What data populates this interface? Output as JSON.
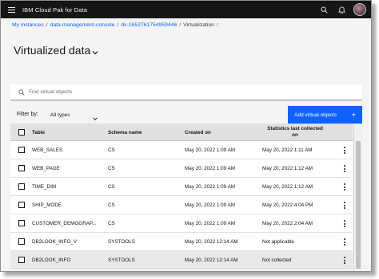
{
  "app": {
    "brand": "IBM Cloud Pak for Data"
  },
  "topbar": {
    "icons": [
      "menu-icon",
      "search-icon",
      "notification-icon",
      "avatar"
    ]
  },
  "breadcrumb": {
    "items": [
      "My instances",
      "data-management-console",
      "dv-1652761754959446",
      "Virtualization"
    ],
    "separator": "/"
  },
  "page": {
    "title": "Virtualized data"
  },
  "search": {
    "placeholder": "Find virtual objects",
    "value": ""
  },
  "filter": {
    "label": "Filter by:",
    "selected": "All types"
  },
  "actions": {
    "add_label": "Add virtual objects",
    "add_icon": "+"
  },
  "table": {
    "headers": {
      "table": "Table",
      "schema": "Schema name",
      "created": "Created on",
      "stats_line1": "Statistics last collected",
      "stats_line2": "on"
    },
    "rows": [
      {
        "table": "WEB_SALES",
        "schema": "CS",
        "created": "May 20, 2022 1:09 AM",
        "stats": "May 20, 2022 1:11 AM"
      },
      {
        "table": "WEB_PAGE",
        "schema": "CS",
        "created": "May 20, 2022 1:09 AM",
        "stats": "May 20, 2022 1:12 AM"
      },
      {
        "table": "TIME_DIM",
        "schema": "CS",
        "created": "May 20, 2022 1:09 AM",
        "stats": "May 20, 2022 1:12 AM"
      },
      {
        "table": "SHIP_MODE",
        "schema": "CS",
        "created": "May 20, 2022 1:09 AM",
        "stats": "May 20, 2022 4:04 PM"
      },
      {
        "table": "CUSTOMER_DEMOGRAP...",
        "schema": "CS",
        "created": "May 20, 2022 1:09 AM",
        "stats": "May 20, 2022 2:04 AM"
      },
      {
        "table": "DB2LOOK_INFO_V",
        "schema": "SYSTOOLS",
        "created": "May 20, 2022 12:14 AM",
        "stats": "Not applicable"
      },
      {
        "table": "DB2LOOK_INFO",
        "schema": "SYSTOOLS",
        "created": "May 20, 2022 12:14 AM",
        "stats": "Not collected"
      }
    ]
  },
  "colors": {
    "topbar": "#161616",
    "accent": "#0f62fe",
    "link": "#0f62fe",
    "header_row": "#e0e0e0"
  }
}
